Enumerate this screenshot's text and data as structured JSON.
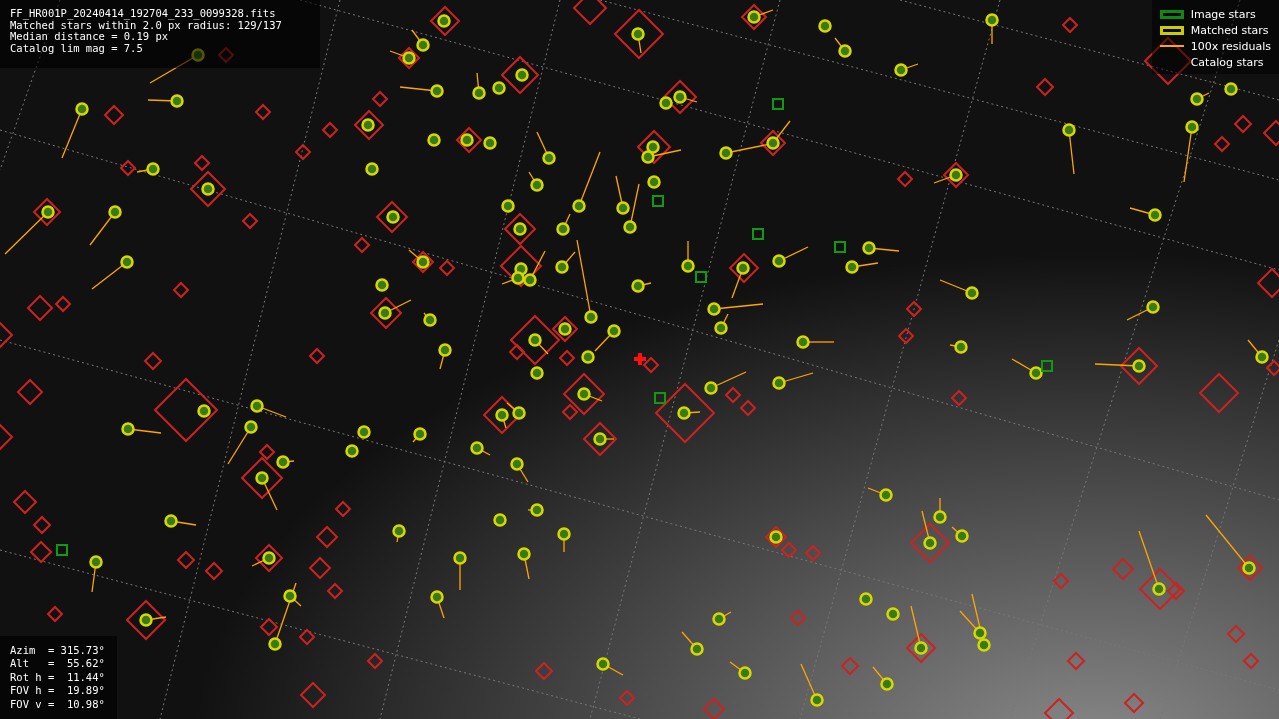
{
  "file_info": [
    "FF_HR001P_20240414_192704_233_0099328.fits",
    "Matched stars within 2.0 px radius: 129/137",
    "Median distance = 0.19 px",
    "Catalog lim mag = 7.5"
  ],
  "legend": [
    {
      "kind": "image",
      "label": "Image stars"
    },
    {
      "kind": "matched",
      "label": "Matched stars"
    },
    {
      "kind": "residual",
      "label": "100x residuals"
    },
    {
      "kind": "catalog",
      "label": "Catalog stars"
    }
  ],
  "pointing": [
    "Azim  = 315.73°",
    "Alt   =  55.62°",
    "Rot h =  11.44°",
    "FOV h =  19.89°",
    "FOV v =  10.98°"
  ]
}
